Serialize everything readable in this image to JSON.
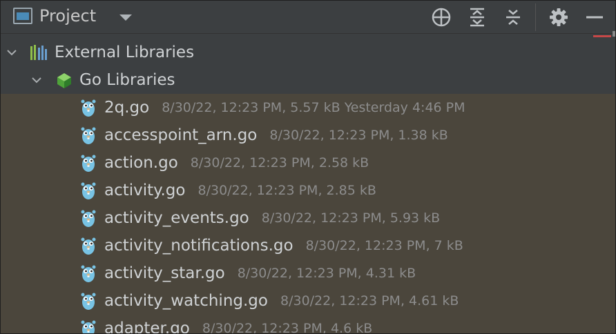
{
  "header": {
    "title": "Project",
    "icons": [
      "project-view-icon",
      "dropdown-arrow-icon",
      "locate-icon",
      "expand-all-icon",
      "collapse-all-icon",
      "gear-icon",
      "minimize-icon"
    ]
  },
  "tree": {
    "external_libraries": {
      "label": "External Libraries",
      "icon": "library-icon"
    },
    "go_libraries": {
      "label": "Go Libraries",
      "icon": "go-libraries-icon"
    },
    "files": [
      {
        "name": "2q.go",
        "meta": "8/30/22, 12:23 PM, 5.57 kB Yesterday 4:46 PM"
      },
      {
        "name": "accesspoint_arn.go",
        "meta": "8/30/22, 12:23 PM, 1.38 kB"
      },
      {
        "name": "action.go",
        "meta": "8/30/22, 12:23 PM, 2.58 kB"
      },
      {
        "name": "activity.go",
        "meta": "8/30/22, 12:23 PM, 2.85 kB"
      },
      {
        "name": "activity_events.go",
        "meta": "8/30/22, 12:23 PM, 5.93 kB"
      },
      {
        "name": "activity_notifications.go",
        "meta": "8/30/22, 12:23 PM, 7 kB"
      },
      {
        "name": "activity_star.go",
        "meta": "8/30/22, 12:23 PM, 4.31 kB"
      },
      {
        "name": "activity_watching.go",
        "meta": "8/30/22, 12:23 PM, 4.61 kB"
      },
      {
        "name": "adapter.go",
        "meta": "8/30/22, 12:23 PM, 4.6 kB"
      }
    ]
  },
  "colors": {
    "panel_bg": "#3c3f41",
    "files_bg": "#4b463c",
    "text": "#cfd2d4",
    "meta_text": "#8c8c8c",
    "gopher": "#78c3e4"
  }
}
